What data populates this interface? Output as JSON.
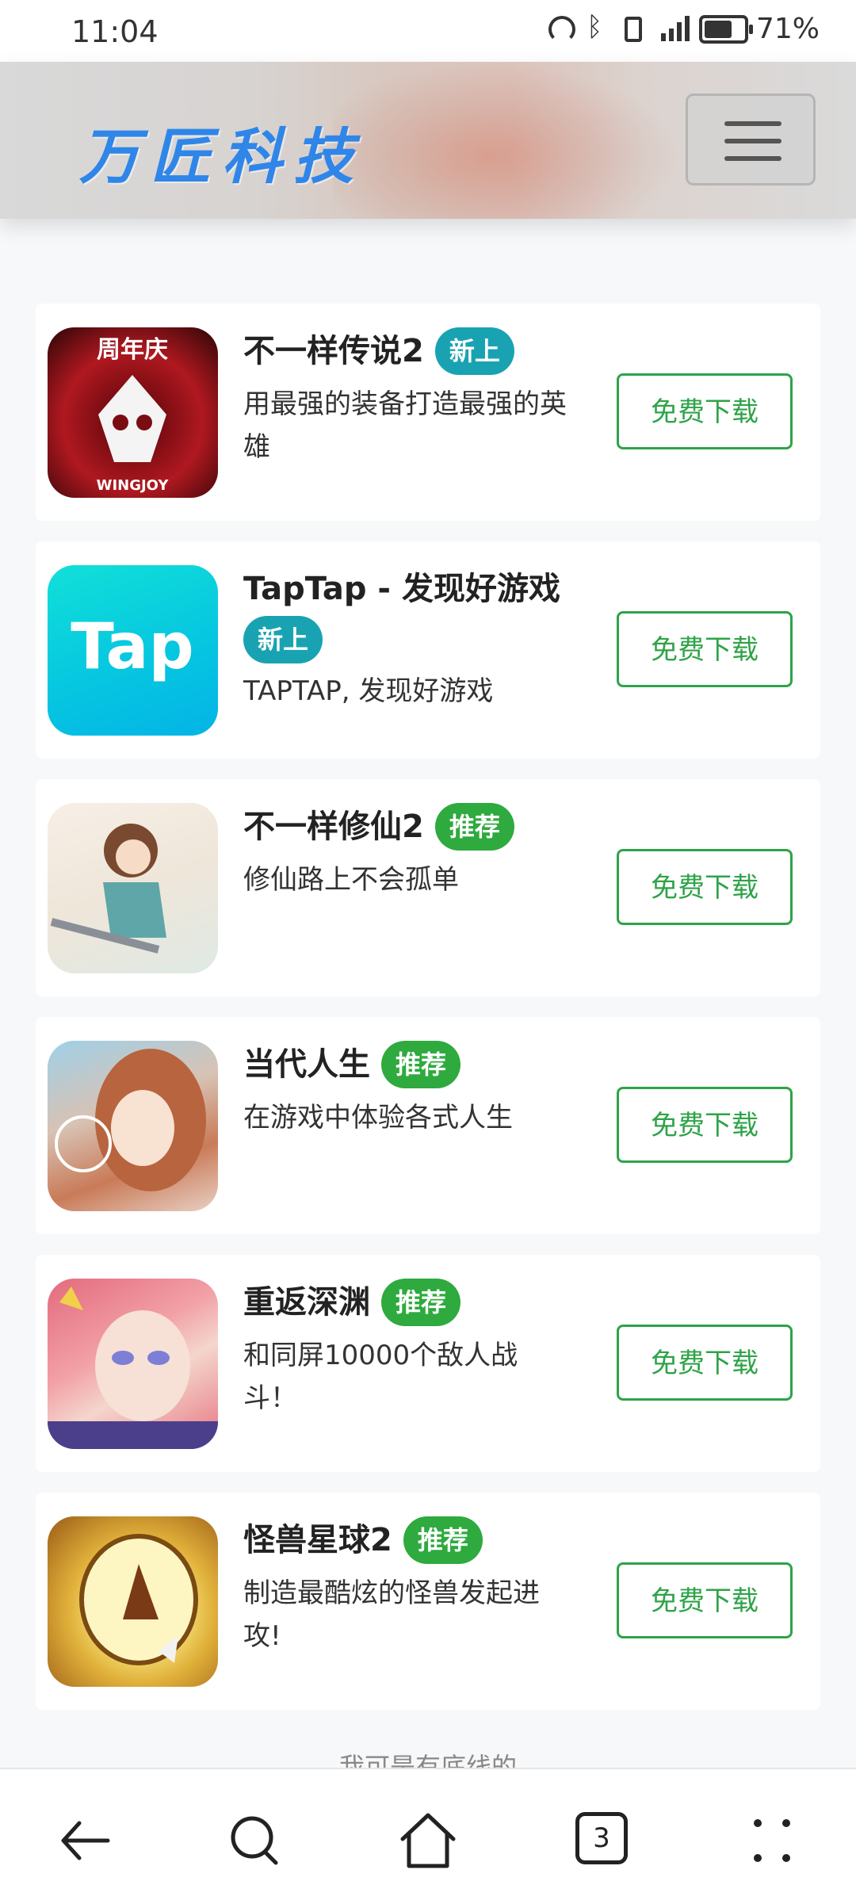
{
  "status_bar": {
    "time": "11:04",
    "battery_percent": "71%"
  },
  "header": {
    "logo_text": "万匠科技",
    "menu_icon": "hamburger-icon"
  },
  "apps": [
    {
      "name": "不一样传说2",
      "badge": "新上",
      "badge_type": "new",
      "description": "用最强的装备打造最强的英雄",
      "button": "免费下载",
      "icon": "game-icon-anniversary"
    },
    {
      "name": "TapTap - 发现好游戏",
      "badge": "新上",
      "badge_type": "new",
      "description": "TAPTAP, 发现好游戏",
      "button": "免费下载",
      "icon": "taptap-icon"
    },
    {
      "name": "不一样修仙2",
      "badge": "推荐",
      "badge_type": "rec",
      "description": "修仙路上不会孤单",
      "button": "免费下载",
      "icon": "game-icon-xiuxian"
    },
    {
      "name": "当代人生",
      "badge": "推荐",
      "badge_type": "rec",
      "description": "在游戏中体验各式人生",
      "button": "免费下载",
      "icon": "game-icon-life"
    },
    {
      "name": "重返深渊",
      "badge": "推荐",
      "badge_type": "rec",
      "description": "和同屏10000个敌人战斗！",
      "button": "免费下载",
      "icon": "game-icon-abyss"
    },
    {
      "name": "怪兽星球2",
      "badge": "推荐",
      "badge_type": "rec",
      "description": "制造最酷炫的怪兽发起进攻!",
      "button": "免费下载",
      "icon": "game-icon-monster"
    }
  ],
  "footer_text": "我可是有底线的",
  "bottom_nav": {
    "tab_count": "3",
    "items": [
      "back-arrow-icon",
      "search-icon",
      "home-icon",
      "tabs-icon",
      "more-icon"
    ]
  },
  "colors": {
    "accent_green": "#2ea348",
    "badge_new": "#19a3b2",
    "badge_recommend": "#2eaa3e",
    "logo_blue": "#2f86e8"
  }
}
